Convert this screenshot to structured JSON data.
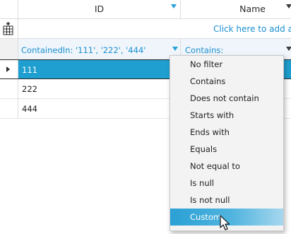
{
  "header": {
    "id_label": "ID",
    "name_label": "Name"
  },
  "new_row": {
    "link_text": "Click here to add a new row"
  },
  "filter_row": {
    "id_filter": "ContainedIn:  '111', '222', '444'",
    "name_filter": "Contains:"
  },
  "rows": [
    {
      "id": "111",
      "selected": true
    },
    {
      "id": "222",
      "selected": false
    },
    {
      "id": "444",
      "selected": false
    }
  ],
  "dropdown": {
    "items": [
      "No filter",
      "Contains",
      "Does not contain",
      "Starts with",
      "Ends with",
      "Equals",
      "Not equal to",
      "Is null",
      "Is not null",
      "Custom"
    ],
    "selected": "Custom"
  },
  "colors": {
    "accent": "#1e9fd0",
    "link": "#1b8fd0",
    "filter_row_bg": "#eff5fb"
  },
  "icons": {
    "new_row_icon": "add-row-icon",
    "filter_icon": "funnel-icon",
    "current_row_icon": "row-indicator-arrow-icon"
  }
}
